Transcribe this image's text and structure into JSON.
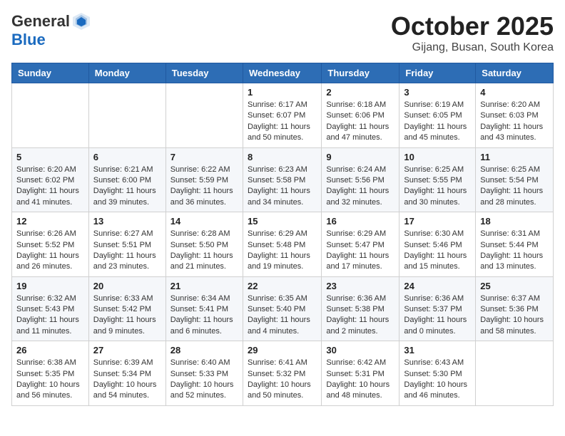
{
  "header": {
    "logo_general": "General",
    "logo_blue": "Blue",
    "month_title": "October 2025",
    "location": "Gijang, Busan, South Korea"
  },
  "weekdays": [
    "Sunday",
    "Monday",
    "Tuesday",
    "Wednesday",
    "Thursday",
    "Friday",
    "Saturday"
  ],
  "weeks": [
    [
      {
        "day": "",
        "info": ""
      },
      {
        "day": "",
        "info": ""
      },
      {
        "day": "",
        "info": ""
      },
      {
        "day": "1",
        "info": "Sunrise: 6:17 AM\nSunset: 6:07 PM\nDaylight: 11 hours and 50 minutes."
      },
      {
        "day": "2",
        "info": "Sunrise: 6:18 AM\nSunset: 6:06 PM\nDaylight: 11 hours and 47 minutes."
      },
      {
        "day": "3",
        "info": "Sunrise: 6:19 AM\nSunset: 6:05 PM\nDaylight: 11 hours and 45 minutes."
      },
      {
        "day": "4",
        "info": "Sunrise: 6:20 AM\nSunset: 6:03 PM\nDaylight: 11 hours and 43 minutes."
      }
    ],
    [
      {
        "day": "5",
        "info": "Sunrise: 6:20 AM\nSunset: 6:02 PM\nDaylight: 11 hours and 41 minutes."
      },
      {
        "day": "6",
        "info": "Sunrise: 6:21 AM\nSunset: 6:00 PM\nDaylight: 11 hours and 39 minutes."
      },
      {
        "day": "7",
        "info": "Sunrise: 6:22 AM\nSunset: 5:59 PM\nDaylight: 11 hours and 36 minutes."
      },
      {
        "day": "8",
        "info": "Sunrise: 6:23 AM\nSunset: 5:58 PM\nDaylight: 11 hours and 34 minutes."
      },
      {
        "day": "9",
        "info": "Sunrise: 6:24 AM\nSunset: 5:56 PM\nDaylight: 11 hours and 32 minutes."
      },
      {
        "day": "10",
        "info": "Sunrise: 6:25 AM\nSunset: 5:55 PM\nDaylight: 11 hours and 30 minutes."
      },
      {
        "day": "11",
        "info": "Sunrise: 6:25 AM\nSunset: 5:54 PM\nDaylight: 11 hours and 28 minutes."
      }
    ],
    [
      {
        "day": "12",
        "info": "Sunrise: 6:26 AM\nSunset: 5:52 PM\nDaylight: 11 hours and 26 minutes."
      },
      {
        "day": "13",
        "info": "Sunrise: 6:27 AM\nSunset: 5:51 PM\nDaylight: 11 hours and 23 minutes."
      },
      {
        "day": "14",
        "info": "Sunrise: 6:28 AM\nSunset: 5:50 PM\nDaylight: 11 hours and 21 minutes."
      },
      {
        "day": "15",
        "info": "Sunrise: 6:29 AM\nSunset: 5:48 PM\nDaylight: 11 hours and 19 minutes."
      },
      {
        "day": "16",
        "info": "Sunrise: 6:29 AM\nSunset: 5:47 PM\nDaylight: 11 hours and 17 minutes."
      },
      {
        "day": "17",
        "info": "Sunrise: 6:30 AM\nSunset: 5:46 PM\nDaylight: 11 hours and 15 minutes."
      },
      {
        "day": "18",
        "info": "Sunrise: 6:31 AM\nSunset: 5:44 PM\nDaylight: 11 hours and 13 minutes."
      }
    ],
    [
      {
        "day": "19",
        "info": "Sunrise: 6:32 AM\nSunset: 5:43 PM\nDaylight: 11 hours and 11 minutes."
      },
      {
        "day": "20",
        "info": "Sunrise: 6:33 AM\nSunset: 5:42 PM\nDaylight: 11 hours and 9 minutes."
      },
      {
        "day": "21",
        "info": "Sunrise: 6:34 AM\nSunset: 5:41 PM\nDaylight: 11 hours and 6 minutes."
      },
      {
        "day": "22",
        "info": "Sunrise: 6:35 AM\nSunset: 5:40 PM\nDaylight: 11 hours and 4 minutes."
      },
      {
        "day": "23",
        "info": "Sunrise: 6:36 AM\nSunset: 5:38 PM\nDaylight: 11 hours and 2 minutes."
      },
      {
        "day": "24",
        "info": "Sunrise: 6:36 AM\nSunset: 5:37 PM\nDaylight: 11 hours and 0 minutes."
      },
      {
        "day": "25",
        "info": "Sunrise: 6:37 AM\nSunset: 5:36 PM\nDaylight: 10 hours and 58 minutes."
      }
    ],
    [
      {
        "day": "26",
        "info": "Sunrise: 6:38 AM\nSunset: 5:35 PM\nDaylight: 10 hours and 56 minutes."
      },
      {
        "day": "27",
        "info": "Sunrise: 6:39 AM\nSunset: 5:34 PM\nDaylight: 10 hours and 54 minutes."
      },
      {
        "day": "28",
        "info": "Sunrise: 6:40 AM\nSunset: 5:33 PM\nDaylight: 10 hours and 52 minutes."
      },
      {
        "day": "29",
        "info": "Sunrise: 6:41 AM\nSunset: 5:32 PM\nDaylight: 10 hours and 50 minutes."
      },
      {
        "day": "30",
        "info": "Sunrise: 6:42 AM\nSunset: 5:31 PM\nDaylight: 10 hours and 48 minutes."
      },
      {
        "day": "31",
        "info": "Sunrise: 6:43 AM\nSunset: 5:30 PM\nDaylight: 10 hours and 46 minutes."
      },
      {
        "day": "",
        "info": ""
      }
    ]
  ]
}
